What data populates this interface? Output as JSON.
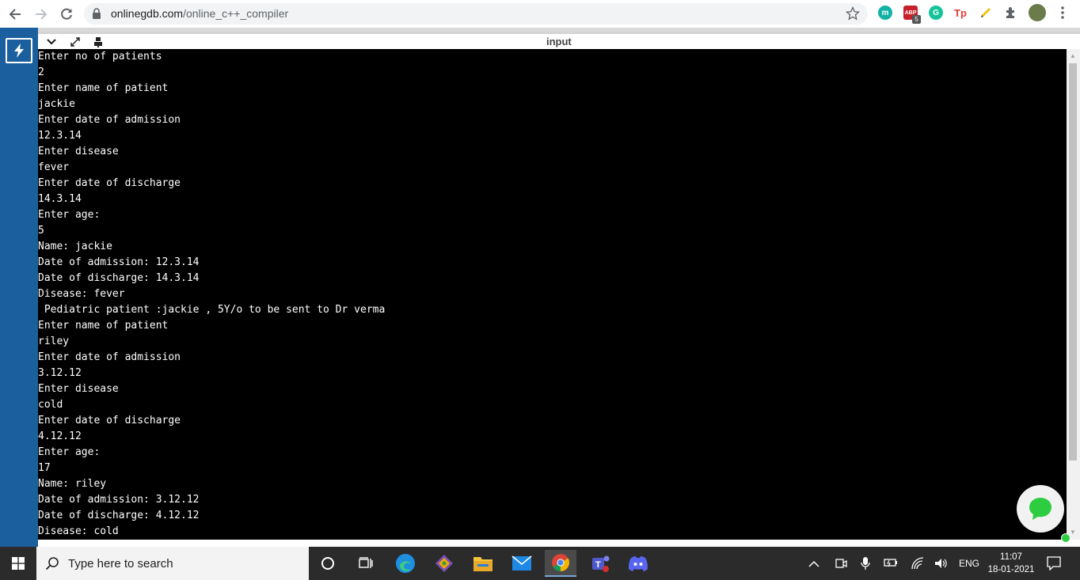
{
  "browser": {
    "url_domain": "onlinegdb.com",
    "url_path": "/online_c++_compiler",
    "extensions": [
      {
        "name": "m-extension-icon",
        "label": "m",
        "color": "#12b2a7"
      },
      {
        "name": "abp-extension-icon",
        "label": "ABP",
        "badge": "5",
        "color": "#c8202a"
      },
      {
        "name": "grammarly-extension-icon",
        "label": "G",
        "color": "#15c39a"
      },
      {
        "name": "tp-extension-icon",
        "label": "Tp",
        "color": "#e53935"
      },
      {
        "name": "highlighter-extension-icon",
        "label": "",
        "color": "#f4c20d"
      }
    ]
  },
  "panel": {
    "title": "input"
  },
  "terminal": {
    "lines": [
      "Enter no of patients",
      "2",
      "Enter name of patient",
      "jackie",
      "Enter date of admission",
      "12.3.14",
      "Enter disease",
      "fever",
      "Enter date of discharge",
      "14.3.14",
      "Enter age:",
      "5",
      "Name: jackie",
      "Date of admission: 12.3.14",
      "Date of discharge: 14.3.14",
      "Disease: fever",
      " Pediatric patient :jackie , 5Y/o to be sent to Dr verma",
      "Enter name of patient",
      "riley",
      "Enter date of admission",
      "3.12.12",
      "Enter disease",
      "cold",
      "Enter date of discharge",
      "4.12.12",
      "Enter age:",
      "17",
      "Name: riley",
      "Date of admission: 3.12.12",
      "Date of discharge: 4.12.12",
      "Disease: cold"
    ]
  },
  "taskbar": {
    "search_placeholder": "Type here to search",
    "language": "ENG",
    "time": "11:07",
    "date": "18-01-2021"
  },
  "colors": {
    "sidebar": "#1c5f9e",
    "terminal_bg": "#000000",
    "terminal_fg": "#ffffff",
    "chat_accent": "#2ecc40"
  }
}
